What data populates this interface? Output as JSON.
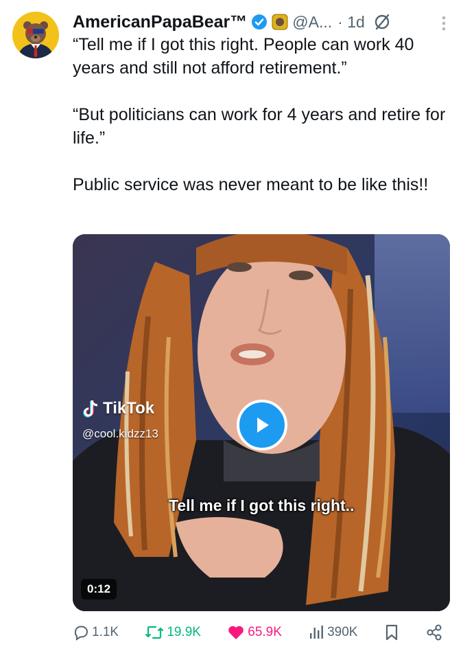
{
  "author": {
    "name": "AmericanPapaBear™",
    "handle": "@A...",
    "time": "· 1d"
  },
  "tweet": {
    "paragraphs": [
      "“Tell me if I got this right. People can work 40 years and still not afford retirement.”",
      "“But politicians can work for 4 years and retire for life.”",
      "Public service was never meant to be like this!!"
    ]
  },
  "media": {
    "watermark_brand": "TikTok",
    "watermark_user": "@cool.kidzz13",
    "caption": "Tell me if I got this right..",
    "duration": "0:12"
  },
  "actions": {
    "replies": "1.1K",
    "reposts": "19.9K",
    "likes": "65.9K",
    "views": "390K"
  },
  "colors": {
    "text": "#0f1419",
    "muted": "#536471",
    "verified": "#1d9bf0",
    "repost": "#00ba7c",
    "like": "#f91880",
    "avatar_bg": "#f2c21b"
  },
  "icons": [
    "verified-badge-icon",
    "org-badge-icon",
    "grok-icon",
    "more-icon",
    "tiktok-logo-icon",
    "play-icon",
    "reply-icon",
    "repost-icon",
    "like-icon",
    "views-icon",
    "bookmark-icon",
    "share-icon"
  ]
}
